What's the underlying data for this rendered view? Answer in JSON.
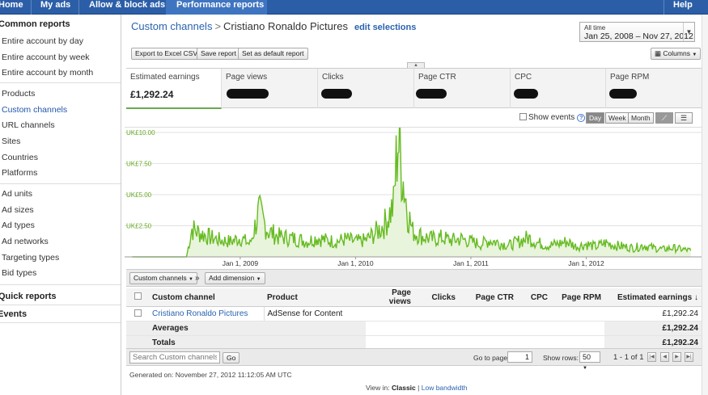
{
  "topnav": {
    "home": "Home",
    "my_ads": "My ads",
    "allow_block": "Allow & block ads",
    "performance": "Performance reports",
    "help": "Help"
  },
  "sidebar": {
    "common_heading": "Common reports",
    "common_items": [
      "Entire account by day",
      "Entire account by week",
      "Entire account by month"
    ],
    "dimension_items": [
      "Products",
      "Custom channels",
      "URL channels",
      "Sites",
      "Countries",
      "Platforms"
    ],
    "ad_items": [
      "Ad units",
      "Ad sizes",
      "Ad types",
      "Ad networks",
      "Targeting types",
      "Bid types"
    ],
    "quick_reports": "Quick reports",
    "events": "Events",
    "active_item": "Custom channels"
  },
  "breadcrumb": {
    "parent": "Custom channels",
    "separator": ">",
    "current": "Cristiano Ronaldo Pictures",
    "edit": "edit selections"
  },
  "daterange": {
    "label": "All time",
    "range": "Jan 25, 2008 – Nov 27, 2012"
  },
  "toolbar": {
    "export": "Export to Excel CSV",
    "save": "Save report",
    "default": "Set as default report",
    "columns": "Columns"
  },
  "metrics": [
    {
      "label": "Estimated earnings",
      "value": "£1,292.24",
      "redacted": false
    },
    {
      "label": "Page views",
      "value": "",
      "redacted": true
    },
    {
      "label": "Clicks",
      "value": "",
      "redacted": true
    },
    {
      "label": "Page CTR",
      "value": "",
      "redacted": true
    },
    {
      "label": "CPC",
      "value": "",
      "redacted": true
    },
    {
      "label": "Page RPM",
      "value": "",
      "redacted": true
    }
  ],
  "chart_controls": {
    "show_events": "Show events",
    "help_glyph": "?",
    "day": "Day",
    "week": "Week",
    "month": "Month",
    "active_granularity": "Day",
    "line_glyph": "⟋",
    "bar_glyph": "☰"
  },
  "chart_data": {
    "type": "area",
    "series": [
      {
        "x": [
          "2008-01-25",
          "2008-04-01",
          "2008-06-01",
          "2008-07-15",
          "2008-08-01",
          "2008-09-01",
          "2008-10-01",
          "2008-11-01",
          "2008-12-01",
          "2009-01-01",
          "2009-02-01",
          "2009-03-01",
          "2009-04-01",
          "2009-05-01",
          "2009-06-01",
          "2009-07-01",
          "2009-08-01",
          "2009-09-01",
          "2009-10-01",
          "2009-11-01",
          "2009-12-01",
          "2010-01-01",
          "2010-02-01",
          "2010-03-01",
          "2010-04-01",
          "2010-05-01",
          "2010-05-15",
          "2010-06-01",
          "2010-06-15",
          "2010-07-01",
          "2010-08-01",
          "2010-09-01",
          "2010-10-01",
          "2010-11-01",
          "2010-12-01",
          "2011-01-01",
          "2011-02-01",
          "2011-03-01",
          "2011-04-01",
          "2011-05-01",
          "2011-06-01",
          "2011-07-01",
          "2011-08-01",
          "2011-09-01",
          "2011-10-01",
          "2011-11-01",
          "2011-12-01",
          "2012-01-01",
          "2012-02-01",
          "2012-03-01",
          "2012-04-01",
          "2012-05-01",
          "2012-06-01",
          "2012-07-01",
          "2012-08-01",
          "2012-09-01",
          "2012-10-01",
          "2012-11-27"
        ],
        "values": [
          0,
          0,
          0,
          0,
          2.2,
          1.8,
          1.5,
          1.3,
          1.2,
          1.5,
          1.0,
          3.5,
          2.0,
          1.6,
          1.5,
          1.4,
          1.2,
          1.5,
          1.3,
          1.2,
          1.4,
          1.2,
          1.3,
          1.8,
          2.5,
          4.0,
          9.5,
          6.0,
          3.5,
          2.0,
          1.6,
          1.4,
          1.5,
          1.3,
          1.4,
          1.2,
          1.0,
          1.3,
          1.1,
          0.9,
          1.2,
          1.5,
          1.1,
          0.9,
          1.0,
          1.2,
          0.8,
          1.0,
          0.8,
          1.1,
          0.9,
          0.8,
          0.7,
          0.9,
          0.7,
          0.6,
          0.7,
          0.5
        ]
      }
    ],
    "y_ticks": [
      "UK£10.00",
      "UK£7.50",
      "UK£5.00",
      "UK£2.50"
    ],
    "x_ticks": [
      "Jan 1, 2009",
      "Jan 1, 2010",
      "Jan 1, 2011",
      "Jan 1, 2012"
    ],
    "ylim": [
      0,
      10
    ],
    "grid": true,
    "line_color": "#66bb22",
    "fill_color": "#e9f4dc"
  },
  "table_tools": {
    "dimension": "Custom channels",
    "arrow": "»",
    "add_dimension": "Add dimension"
  },
  "table": {
    "columns": [
      "Custom channel",
      "Product",
      "Page views",
      "Clicks",
      "Page CTR",
      "CPC",
      "Page RPM",
      "Estimated earnings"
    ],
    "sort_glyph": "↓",
    "rows": [
      {
        "channel": "Cristiano Ronaldo Pictures",
        "product": "AdSense for Content",
        "earnings": "£1,292.24"
      }
    ],
    "averages_label": "Averages",
    "averages_earnings": "£1,292.24",
    "totals_label": "Totals",
    "totals_earnings": "£1,292.24"
  },
  "table_footer": {
    "search_placeholder": "Search Custom channels",
    "go": "Go",
    "goto_label": "Go to page:",
    "page": "1",
    "rows_label": "Show rows:",
    "rows_value": "50",
    "range": "1 - 1 of 1"
  },
  "footer": {
    "generated": "Generated on: November 27, 2012 11:12:05 AM UTC",
    "view_in": "View in:",
    "classic": "Classic",
    "separator": "|",
    "low_bandwidth": "Low bandwidth"
  },
  "colors": {
    "nav_blue": "#2b5ea7",
    "link_blue": "#2a63b0",
    "chart_green": "#66bb22"
  }
}
